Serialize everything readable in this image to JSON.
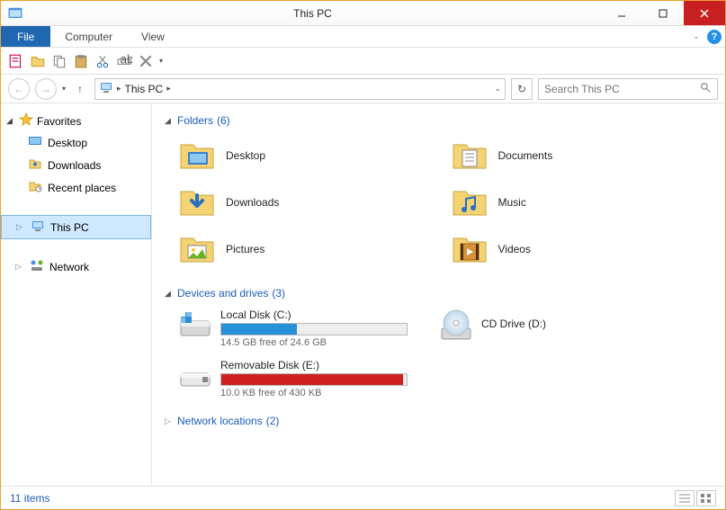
{
  "window": {
    "title": "This PC"
  },
  "ribbon": {
    "file": "File",
    "tabs": [
      "Computer",
      "View"
    ]
  },
  "breadcrumb": {
    "current": "This PC"
  },
  "search": {
    "placeholder": "Search This PC"
  },
  "sidebar": {
    "favorites": {
      "label": "Favorites",
      "items": [
        "Desktop",
        "Downloads",
        "Recent places"
      ]
    },
    "thispc": {
      "label": "This PC"
    },
    "network": {
      "label": "Network"
    }
  },
  "sections": {
    "folders": {
      "label": "Folders",
      "count": "(6)",
      "items": [
        "Desktop",
        "Documents",
        "Downloads",
        "Music",
        "Pictures",
        "Videos"
      ]
    },
    "drives": {
      "label": "Devices and drives",
      "count": "(3)",
      "items": [
        {
          "name": "Local Disk (C:)",
          "free": "14.5 GB free of 24.6 GB",
          "fill_pct": 41,
          "color": "blue"
        },
        {
          "name": "CD Drive (D:)"
        },
        {
          "name": "Removable Disk (E:)",
          "free": "10.0 KB free of 430 KB",
          "fill_pct": 98,
          "color": "red"
        }
      ]
    },
    "netloc": {
      "label": "Network locations",
      "count": "(2)"
    }
  },
  "status": {
    "text": "11 items"
  }
}
